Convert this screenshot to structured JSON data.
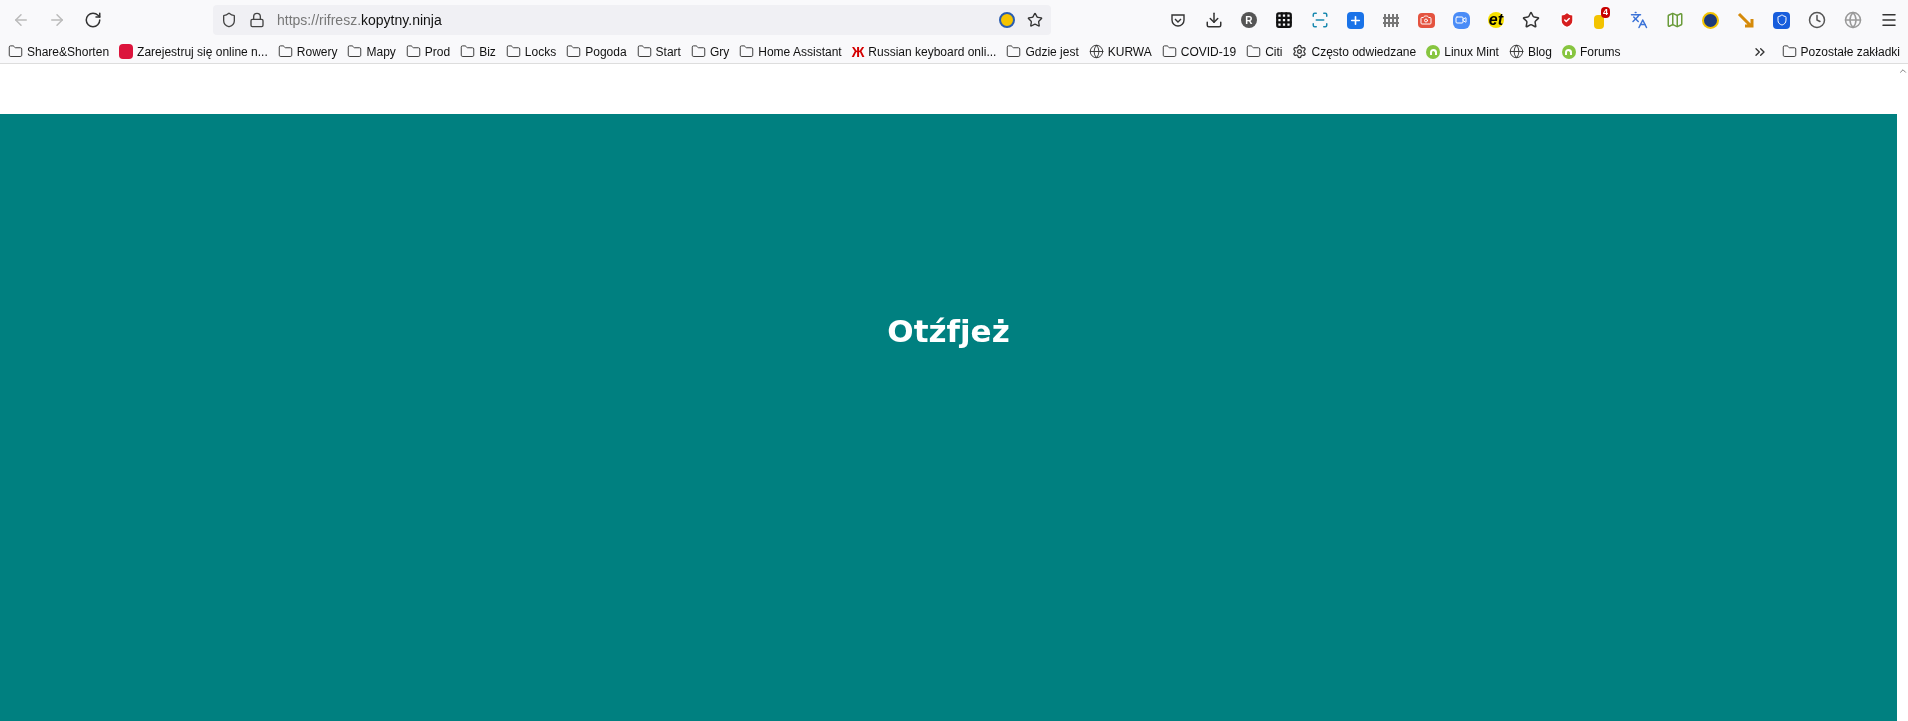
{
  "address_bar": {
    "url_prefix": "https://rifresz.",
    "url_domain": "kopytny.ninja"
  },
  "toolbar_icons": [
    {
      "kind": "pocket"
    },
    {
      "kind": "download"
    },
    {
      "kind": "avatar",
      "text": "R"
    },
    {
      "kind": "grid"
    },
    {
      "kind": "screenshot"
    },
    {
      "kind": "plus"
    },
    {
      "kind": "fence"
    },
    {
      "kind": "camera"
    },
    {
      "kind": "video"
    },
    {
      "kind": "text",
      "text": "et"
    },
    {
      "kind": "star"
    },
    {
      "kind": "shield"
    },
    {
      "kind": "badge",
      "text": "4"
    },
    {
      "kind": "translate"
    },
    {
      "kind": "map"
    },
    {
      "kind": "eu"
    },
    {
      "kind": "arrow"
    },
    {
      "kind": "bitwarden"
    },
    {
      "kind": "clock"
    },
    {
      "kind": "globe"
    },
    {
      "kind": "menu"
    }
  ],
  "bookmarks": [
    {
      "kind": "folder",
      "label": "Share&Shorten"
    },
    {
      "kind": "flag",
      "label": "Zarejestruj się online n..."
    },
    {
      "kind": "folder",
      "label": "Rowery"
    },
    {
      "kind": "folder",
      "label": "Mapy"
    },
    {
      "kind": "folder",
      "label": "Prod"
    },
    {
      "kind": "folder",
      "label": "Biz"
    },
    {
      "kind": "folder",
      "label": "Locks"
    },
    {
      "kind": "folder",
      "label": "Pogoda"
    },
    {
      "kind": "folder",
      "label": "Start"
    },
    {
      "kind": "folder",
      "label": "Gry"
    },
    {
      "kind": "folder",
      "label": "Home Assistant"
    },
    {
      "kind": "glyph",
      "glyph": "Ж",
      "label": "Russian keyboard onli..."
    },
    {
      "kind": "folder",
      "label": "Gdzie jest"
    },
    {
      "kind": "globe",
      "label": "KURWA"
    },
    {
      "kind": "folder",
      "label": "COVID-19"
    },
    {
      "kind": "folder",
      "label": "Citi"
    },
    {
      "kind": "gear",
      "label": "Często odwiedzane"
    },
    {
      "kind": "mint",
      "label": "Linux Mint"
    },
    {
      "kind": "globe",
      "label": "Blog"
    },
    {
      "kind": "mint",
      "label": "Forums"
    }
  ],
  "other_bookmarks": {
    "label": "Pozostałe zakładki"
  },
  "page": {
    "heading": "Otźfjeż"
  }
}
